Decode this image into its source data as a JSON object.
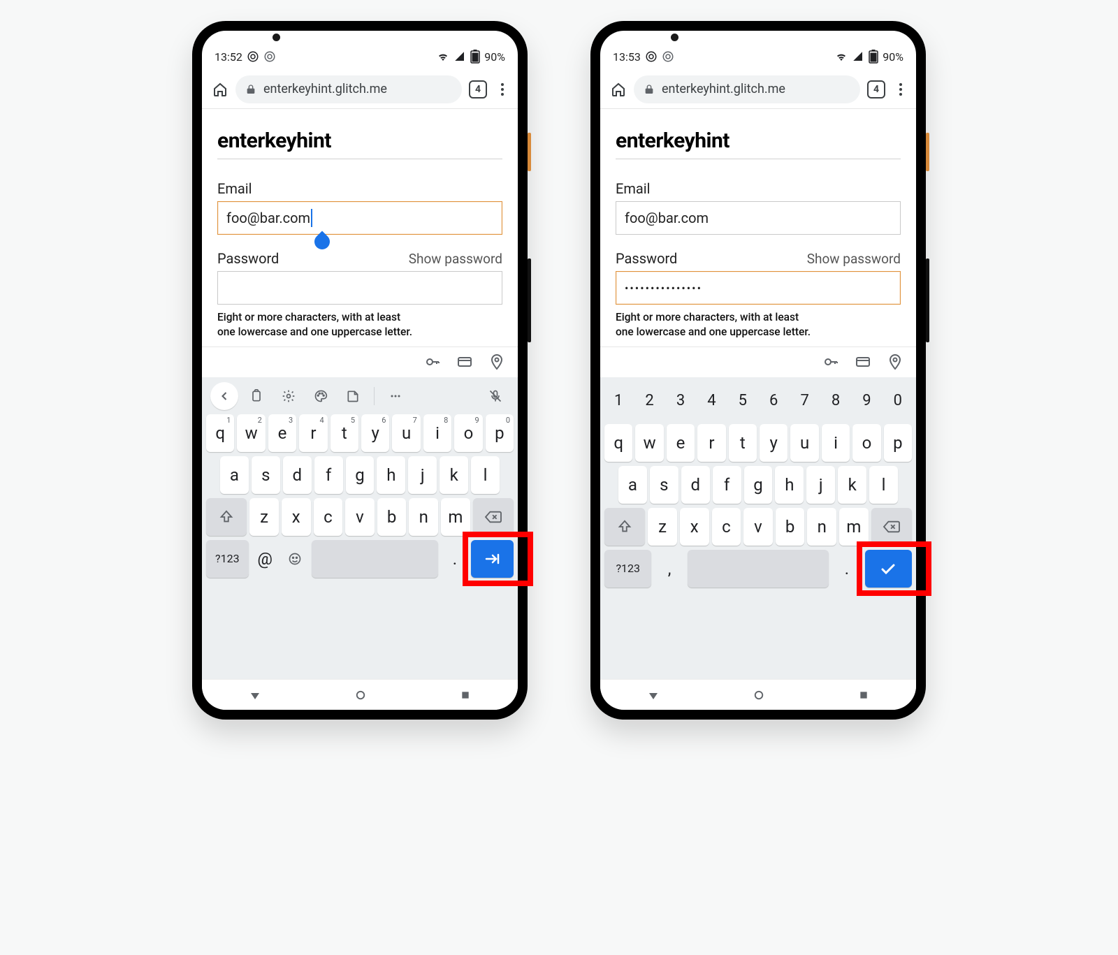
{
  "phones": [
    {
      "time": "13:52",
      "battery": "90%",
      "url": "enterkeyhint.glitch.me",
      "tab_count": "4",
      "page_title": "enterkeyhint",
      "email_label": "Email",
      "email_value": "foo@bar.com",
      "email_focused": true,
      "password_label": "Password",
      "show_password": "Show password",
      "password_value": "",
      "password_focused": false,
      "hint_line1": "Eight or more characters, with at least",
      "hint_line2": "one lowercase and one uppercase letter.",
      "kbd_has_toolbar": true,
      "kbd_number_row": false,
      "row1": [
        {
          "k": "q",
          "s": "1"
        },
        {
          "k": "w",
          "s": "2"
        },
        {
          "k": "e",
          "s": "3"
        },
        {
          "k": "r",
          "s": "4"
        },
        {
          "k": "t",
          "s": "5"
        },
        {
          "k": "y",
          "s": "6"
        },
        {
          "k": "u",
          "s": "7"
        },
        {
          "k": "i",
          "s": "8"
        },
        {
          "k": "o",
          "s": "9"
        },
        {
          "k": "p",
          "s": "0"
        }
      ],
      "row2": [
        "a",
        "s",
        "d",
        "f",
        "g",
        "h",
        "j",
        "k",
        "l"
      ],
      "row3": [
        "z",
        "x",
        "c",
        "v",
        "b",
        "n",
        "m"
      ],
      "bottom_sym": "?123",
      "bottom_left": "@",
      "bottom_emoji": true,
      "bottom_dot": ".",
      "enter_type": "next"
    },
    {
      "time": "13:53",
      "battery": "90%",
      "url": "enterkeyhint.glitch.me",
      "tab_count": "4",
      "page_title": "enterkeyhint",
      "email_label": "Email",
      "email_value": "foo@bar.com",
      "email_focused": false,
      "password_label": "Password",
      "show_password": "Show password",
      "password_value": "•••••••••••••••",
      "password_focused": true,
      "hint_line1": "Eight or more characters, with at least",
      "hint_line2": "one lowercase and one uppercase letter.",
      "kbd_has_toolbar": false,
      "kbd_number_row": true,
      "num_row": [
        "1",
        "2",
        "3",
        "4",
        "5",
        "6",
        "7",
        "8",
        "9",
        "0"
      ],
      "row1": [
        {
          "k": "q"
        },
        {
          "k": "w"
        },
        {
          "k": "e"
        },
        {
          "k": "r"
        },
        {
          "k": "t"
        },
        {
          "k": "y"
        },
        {
          "k": "u"
        },
        {
          "k": "i"
        },
        {
          "k": "o"
        },
        {
          "k": "p"
        }
      ],
      "row2": [
        "a",
        "s",
        "d",
        "f",
        "g",
        "h",
        "j",
        "k",
        "l"
      ],
      "row3": [
        "z",
        "x",
        "c",
        "v",
        "b",
        "n",
        "m"
      ],
      "bottom_sym": "?123",
      "bottom_left": ",",
      "bottom_emoji": false,
      "bottom_dot": ".",
      "enter_type": "done"
    }
  ]
}
